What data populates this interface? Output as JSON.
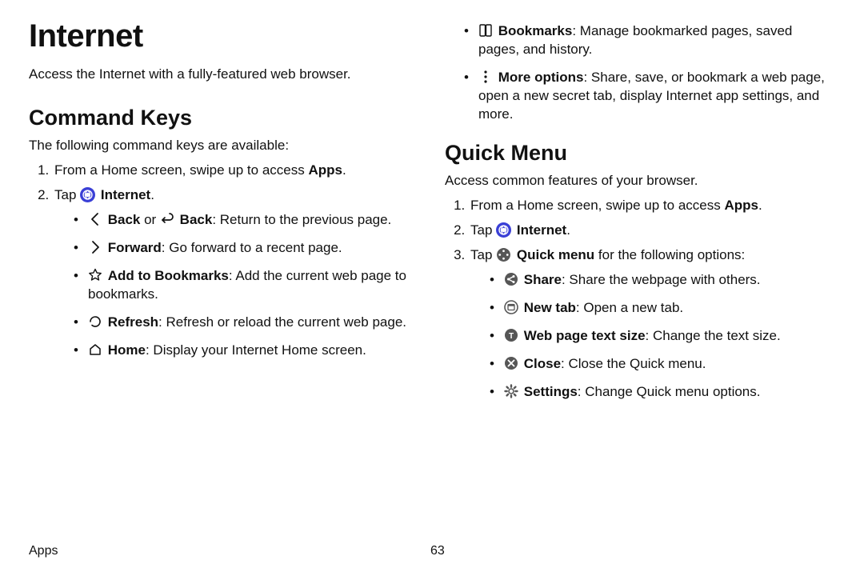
{
  "footer": {
    "section": "Apps",
    "page": "63"
  },
  "left": {
    "title": "Internet",
    "intro": "Access the Internet with a fully-featured web browser.",
    "section_title": "Command Keys",
    "section_intro": "The following command keys are available:",
    "steps": {
      "s1_pre": "From a Home screen, swipe up to access ",
      "s1_bold": "Apps",
      "s1_post": ".",
      "s2_pre": "Tap ",
      "s2_bold": "Internet",
      "s2_post": "."
    },
    "cmd": {
      "back_b1": "Back",
      "back_mid": " or ",
      "back_b2": "Back",
      "back_post": ": Return to the previous page.",
      "fwd_b": "Forward",
      "fwd_post": ": Go forward to a recent page.",
      "add_b": "Add to Bookmarks",
      "add_post": ": Add the current web page to bookmarks.",
      "ref_b": "Refresh",
      "ref_post": ": Refresh or reload the current web page.",
      "home_b": "Home",
      "home_post": ": Display your Internet Home screen."
    }
  },
  "right": {
    "top": {
      "bm_b": "Bookmarks",
      "bm_post": ": Manage bookmarked pages, saved pages, and history.",
      "more_b": "More options",
      "more_post": ": Share, save, or bookmark a web page, open a new secret tab, display Internet app settings, and more."
    },
    "section_title": "Quick Menu",
    "section_intro": "Access common features of your browser.",
    "steps": {
      "s1_pre": "From a Home screen, swipe up to access ",
      "s1_bold": "Apps",
      "s1_post": ".",
      "s2_pre": "Tap ",
      "s2_bold": "Internet",
      "s2_post": ".",
      "s3_pre": "Tap ",
      "s3_bold": "Quick menu",
      "s3_post": " for the following options:"
    },
    "qm": {
      "share_b": "Share",
      "share_post": ": Share the webpage with others.",
      "new_b": "New tab",
      "new_post": ": Open a new tab.",
      "text_b": "Web page text size",
      "text_post": ": Change the text size.",
      "close_b": "Close",
      "close_post": ": Close the Quick menu.",
      "set_b": "Settings",
      "set_post": ": Change Quick menu options."
    }
  }
}
